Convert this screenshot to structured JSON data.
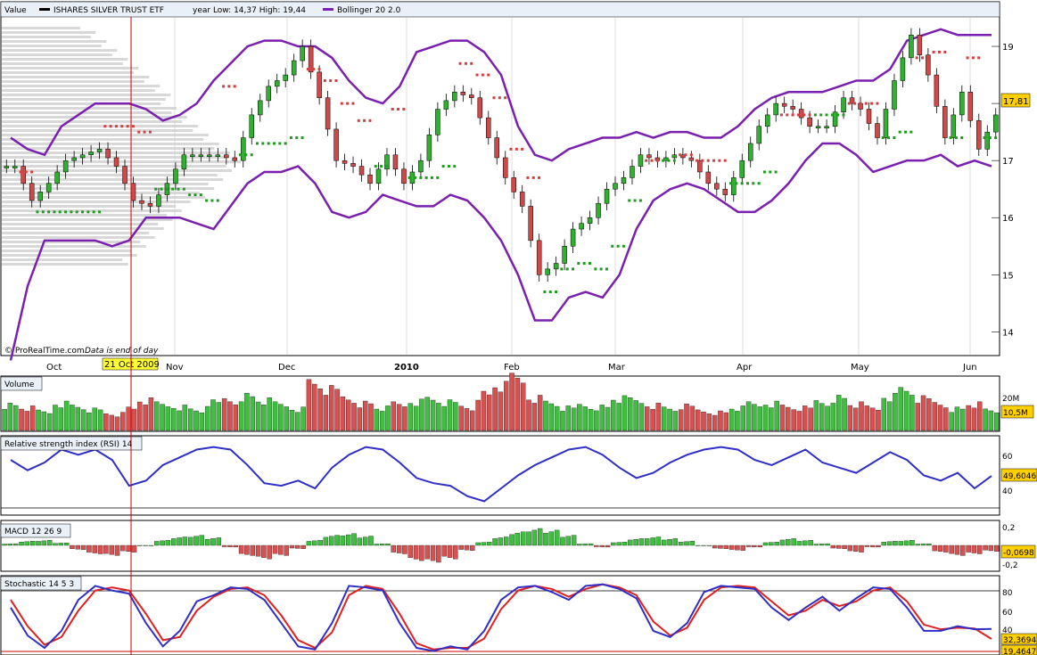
{
  "colors": {
    "bollinger": "#7a1fb0",
    "up_candle": "#2fb02f",
    "down_candle": "#d04848",
    "sar_up": "#1e9a1e",
    "sar_down": "#d04040",
    "vol_up": "#3fbf3f",
    "vol_down": "#d85050",
    "rsi": "#2e2ec8",
    "stoch_k": "#2e2ec8",
    "stoch_d": "#e02020",
    "cursor": "#cc0000",
    "price_tag": "#ffd000",
    "volume_profile": "#b8b8b8"
  },
  "price_panel": {
    "tab_label": "Value",
    "symbol": "ISHARES SILVER TRUST ETF",
    "year_range": "year Low: 14,37  High: 19,44",
    "indicator": "Bollinger 20 2.0",
    "watermark": "© ProRealTime.com",
    "watermark_note": "Data is end of day",
    "last_price": "17,81"
  },
  "x_axis": {
    "months": [
      "Oct",
      "Nov",
      "Dec",
      "2010",
      "Feb",
      "Mar",
      "Apr",
      "May",
      "Jun"
    ],
    "cursor_date": "21 Oct 2009"
  },
  "volume_panel": {
    "tab_label": "Volume",
    "tick_label": "20M",
    "last_value": "10,5M"
  },
  "rsi_panel": {
    "tab_label": "Relative strength index (RSI) 14",
    "ticks": [
      "60",
      "40"
    ],
    "last_value": "49,6046"
  },
  "macd_panel": {
    "tab_label": "MACD 12 26 9",
    "ticks": [
      "0,2",
      "0",
      "-0,2"
    ],
    "last_value": "-0,0698"
  },
  "stoch_panel": {
    "tab_label": "Stochastic 14 5 3",
    "ticks": [
      "80",
      "60",
      "40"
    ],
    "last_k": "32,3694",
    "last_d": "19,4647"
  },
  "chart_data": [
    {
      "type": "candlestick",
      "title": "ISHARES SILVER TRUST ETF",
      "ylim": [
        13.6,
        19.5
      ],
      "yticks": [
        14,
        15,
        16,
        17,
        18,
        19
      ],
      "weekly_close": [
        16.9,
        16.3,
        16.6,
        17.0,
        17.1,
        17.2,
        16.9,
        16.3,
        16.2,
        16.6,
        17.1,
        17.1,
        17.1,
        17.0,
        17.8,
        18.3,
        18.5,
        19.0,
        18.1,
        17.0,
        16.9,
        16.6,
        17.1,
        16.6,
        17.0,
        17.9,
        18.2,
        18.1,
        17.4,
        16.7,
        16.2,
        15.0,
        15.2,
        15.8,
        16.0,
        16.5,
        16.7,
        17.1,
        17.0,
        17.1,
        17.0,
        16.6,
        16.4,
        17.0,
        17.6,
        18.0,
        17.9,
        17.6,
        17.6,
        18.1,
        17.9,
        17.4,
        18.4,
        19.2,
        18.5,
        17.4,
        18.2,
        17.2,
        17.8
      ],
      "bollinger_upper": [
        17.4,
        17.2,
        17.1,
        17.6,
        17.8,
        18.0,
        18.0,
        18.0,
        17.9,
        17.7,
        17.8,
        18.0,
        18.4,
        18.7,
        19.0,
        19.1,
        19.1,
        19.0,
        19.0,
        18.8,
        18.4,
        18.1,
        18.0,
        18.3,
        18.9,
        19.0,
        19.1,
        19.1,
        18.9,
        18.5,
        17.6,
        17.1,
        17.0,
        17.2,
        17.3,
        17.4,
        17.4,
        17.5,
        17.4,
        17.5,
        17.5,
        17.4,
        17.4,
        17.6,
        17.9,
        18.1,
        18.2,
        18.2,
        18.2,
        18.3,
        18.4,
        18.4,
        18.6,
        19.1,
        19.2,
        19.3,
        19.2,
        19.2,
        19.2
      ],
      "bollinger_lower": [
        13.5,
        14.8,
        15.6,
        15.6,
        15.6,
        15.6,
        15.5,
        15.6,
        16.0,
        16.0,
        16.0,
        15.9,
        15.8,
        16.2,
        16.6,
        16.8,
        16.8,
        16.9,
        16.6,
        16.1,
        16.0,
        16.1,
        16.4,
        16.3,
        16.2,
        16.2,
        16.4,
        16.3,
        16.0,
        15.6,
        15.0,
        14.2,
        14.2,
        14.6,
        14.7,
        14.6,
        15.0,
        15.8,
        16.3,
        16.5,
        16.6,
        16.5,
        16.3,
        16.1,
        16.1,
        16.3,
        16.6,
        17.0,
        17.3,
        17.3,
        17.1,
        16.8,
        16.9,
        17.0,
        17.0,
        17.1,
        16.9,
        17.0,
        16.9
      ]
    },
    {
      "type": "bar",
      "title": "Volume",
      "unit": "M",
      "values_m": [
        14,
        12,
        10,
        15,
        13,
        11,
        9,
        12,
        16,
        14,
        13,
        11,
        15,
        17,
        19,
        16,
        14,
        12,
        26,
        22,
        18,
        15,
        12,
        14,
        16,
        17,
        15,
        13,
        20,
        24,
        28,
        18,
        15,
        12,
        14,
        13,
        17,
        16,
        14,
        12,
        13,
        11,
        10,
        12,
        14,
        15,
        13,
        12,
        16,
        18,
        14,
        12,
        19,
        22,
        17,
        15,
        12,
        14,
        10.5
      ]
    },
    {
      "type": "line",
      "title": "Relative strength index (RSI) 14",
      "yticks": [
        40,
        60
      ],
      "values": [
        62,
        54,
        60,
        70,
        66,
        70,
        62,
        42,
        46,
        58,
        64,
        70,
        72,
        70,
        58,
        44,
        42,
        46,
        40,
        56,
        66,
        72,
        70,
        60,
        48,
        44,
        42,
        34,
        30,
        40,
        50,
        58,
        64,
        70,
        72,
        66,
        56,
        48,
        52,
        60,
        66,
        70,
        72,
        70,
        62,
        58,
        64,
        70,
        60,
        56,
        52,
        60,
        68,
        62,
        50,
        46,
        52,
        40,
        49.6
      ]
    },
    {
      "type": "bar",
      "title": "MACD 12 26 9",
      "yticks": [
        -0.2,
        0,
        0.2
      ],
      "values": [
        0.02,
        0.05,
        0.06,
        0.03,
        -0.05,
        -0.1,
        -0.12,
        -0.08,
        0.0,
        0.06,
        0.1,
        0.12,
        0.09,
        -0.02,
        -0.12,
        -0.16,
        -0.12,
        -0.04,
        0.06,
        0.12,
        0.14,
        0.11,
        0.02,
        -0.1,
        -0.18,
        -0.2,
        -0.16,
        -0.06,
        0.04,
        0.1,
        0.16,
        0.2,
        0.18,
        0.12,
        0.02,
        -0.02,
        0.04,
        0.08,
        0.1,
        0.08,
        0.05,
        0.0,
        -0.04,
        -0.06,
        -0.02,
        0.04,
        0.08,
        0.06,
        0.02,
        -0.04,
        -0.08,
        -0.02,
        0.05,
        0.06,
        0.02,
        -0.08,
        -0.12,
        -0.1,
        -0.07
      ]
    },
    {
      "type": "line",
      "title": "Stochastic 14 5 3",
      "yticks": [
        40,
        60,
        80
      ],
      "series": [
        {
          "name": "%K",
          "values": [
            60,
            24,
            8,
            30,
            70,
            88,
            82,
            78,
            40,
            10,
            30,
            68,
            76,
            86,
            84,
            70,
            40,
            10,
            6,
            40,
            88,
            86,
            82,
            40,
            8,
            4,
            10,
            6,
            30,
            70,
            86,
            88,
            80,
            70,
            88,
            90,
            84,
            72,
            30,
            22,
            40,
            80,
            88,
            86,
            84,
            60,
            44,
            60,
            74,
            56,
            72,
            86,
            84,
            60,
            30,
            30,
            36,
            32,
            32.4
          ]
        },
        {
          "name": "%D",
          "values": [
            70,
            36,
            12,
            22,
            56,
            82,
            86,
            82,
            52,
            18,
            22,
            56,
            74,
            84,
            86,
            76,
            50,
            18,
            8,
            28,
            76,
            88,
            84,
            52,
            14,
            6,
            8,
            8,
            20,
            58,
            82,
            88,
            84,
            74,
            84,
            90,
            86,
            76,
            42,
            24,
            34,
            70,
            86,
            88,
            86,
            68,
            50,
            56,
            70,
            62,
            68,
            82,
            86,
            68,
            38,
            32,
            34,
            33,
            19.5
          ]
        }
      ]
    }
  ]
}
